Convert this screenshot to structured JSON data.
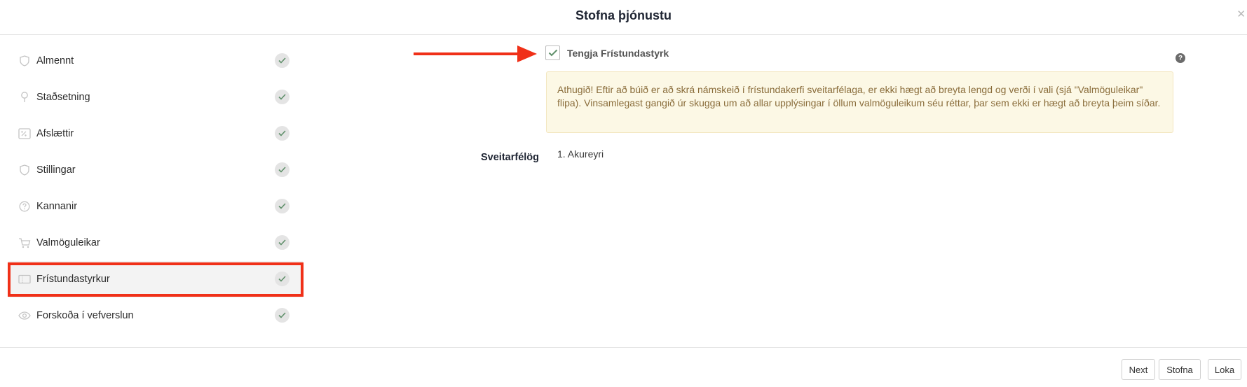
{
  "modal": {
    "title": "Stofna þjónustu",
    "close_glyph": "✕"
  },
  "sidebar": {
    "items": [
      {
        "label": "Almennt",
        "icon": "shield-icon",
        "complete": true
      },
      {
        "label": "Staðsetning",
        "icon": "map-pin-icon",
        "complete": true
      },
      {
        "label": "Afslættir",
        "icon": "discount-icon",
        "complete": true
      },
      {
        "label": "Stillingar",
        "icon": "shield-icon",
        "complete": true
      },
      {
        "label": "Kannanir",
        "icon": "question-circle-icon",
        "complete": true
      },
      {
        "label": "Valmöguleikar",
        "icon": "cart-icon",
        "complete": true
      },
      {
        "label": "Frístundastyrkur",
        "icon": "ticket-icon",
        "complete": true,
        "active": true
      },
      {
        "label": "Forskoða í vefverslun",
        "icon": "eye-icon",
        "complete": true
      }
    ]
  },
  "content": {
    "checkbox_label": "Tengja Frístundastyrk",
    "checkbox_checked": true,
    "help_glyph": "?",
    "warning_text": "Athugið! Eftir að búið er að skrá námskeið í frístundakerfi sveitarfélaga, er ekki hægt að breyta lengd og verði í vali (sjá \"Valmöguleikar\" flipa). Vinsamlegast gangið úr skugga um að allar upplýsingar í öllum valmöguleikum séu réttar, þar sem ekki er hægt að breyta þeim síðar.",
    "municipalities_label": "Sveitarfélög",
    "municipalities": [
      "1. Akureyri"
    ]
  },
  "footer": {
    "next_label": "Next",
    "create_label": "Stofna",
    "close_label": "Loka"
  },
  "colors": {
    "highlight_red": "#f03018",
    "warning_bg": "#fcf8e5",
    "warning_text": "#8a6d3b",
    "check_green": "#5f8f6a"
  }
}
